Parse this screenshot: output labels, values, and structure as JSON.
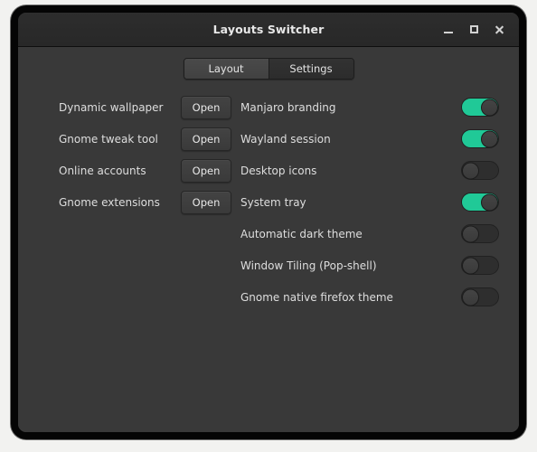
{
  "window": {
    "title": "Layouts Switcher",
    "controls": [
      {
        "name": "minimize-button",
        "icon": "minimize-icon",
        "label": "_"
      },
      {
        "name": "maximize-button",
        "icon": "maximize-icon",
        "label": "□"
      },
      {
        "name": "close-button",
        "icon": "close-icon",
        "label": "✕"
      }
    ]
  },
  "tabs": [
    {
      "label": "Layout",
      "active": true
    },
    {
      "label": "Settings",
      "active": false
    }
  ],
  "left_column": {
    "button_label": "Open",
    "rows": [
      {
        "label": "Dynamic wallpaper"
      },
      {
        "label": "Gnome tweak tool"
      },
      {
        "label": "Online accounts"
      },
      {
        "label": "Gnome extensions"
      }
    ]
  },
  "right_column": {
    "rows": [
      {
        "label": "Manjaro branding",
        "state": "on"
      },
      {
        "label": "Wayland session",
        "state": "on"
      },
      {
        "label": "Desktop icons",
        "state": "off"
      },
      {
        "label": "System tray",
        "state": "on"
      },
      {
        "label": "Automatic dark theme",
        "state": "off"
      },
      {
        "label": "Window Tiling (Pop-shell)",
        "state": "off"
      },
      {
        "label": "Gnome native firefox theme",
        "state": "off"
      }
    ]
  },
  "colors": {
    "accent_on": "#20c997",
    "window_bg": "#393939",
    "titlebar_bg": "#2a2a2a",
    "text": "#dedede",
    "desktop_bg": "#f2f2f0"
  }
}
